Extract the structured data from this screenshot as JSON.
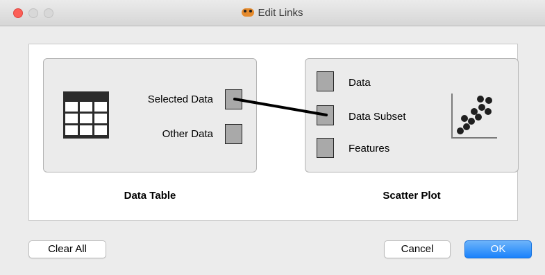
{
  "window": {
    "title": "Edit Links",
    "app_icon": "glue-icon"
  },
  "left_panel": {
    "caption": "Data Table",
    "icon": "table-icon",
    "items": [
      {
        "label": "Selected Data"
      },
      {
        "label": "Other Data"
      }
    ]
  },
  "right_panel": {
    "caption": "Scatter Plot",
    "icon": "scatter-plot-icon",
    "items": [
      {
        "label": "Data"
      },
      {
        "label": "Data Subset"
      },
      {
        "label": "Features"
      }
    ]
  },
  "links": [
    {
      "from": "Selected Data",
      "to": "Data Subset"
    }
  ],
  "buttons": {
    "clear_all": "Clear All",
    "cancel": "Cancel",
    "ok": "OK"
  },
  "colors": {
    "ok_button": "#1a82fb",
    "close_button": "#fc5f57",
    "port_fill": "#a9a9a9"
  }
}
